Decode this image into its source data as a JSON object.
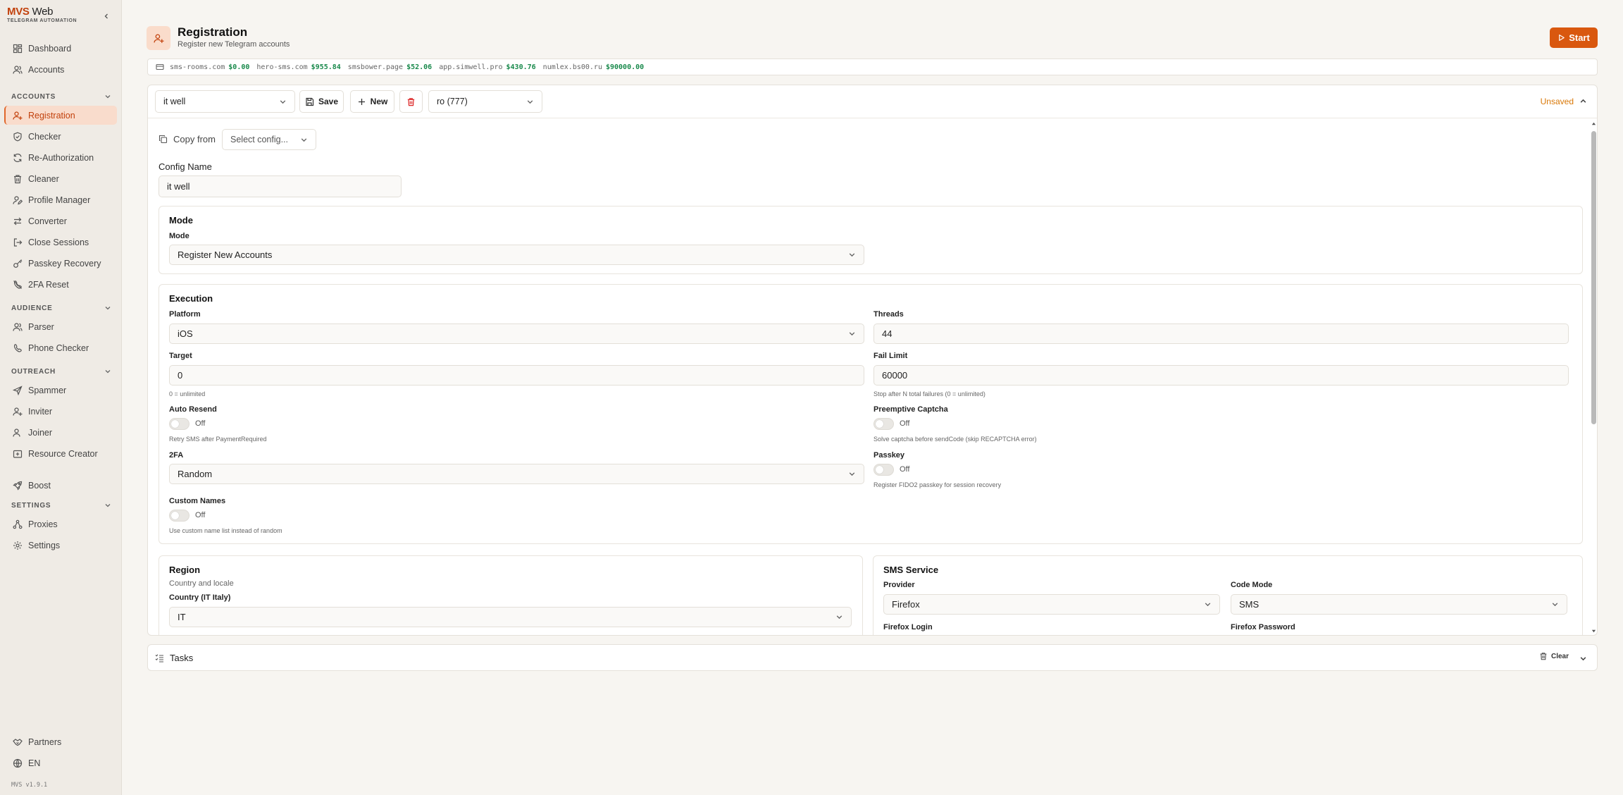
{
  "sidebar": {
    "logo_brand": "MVS",
    "logo_web": "Web",
    "logo_sub": "TELEGRAM AUTOMATION",
    "top_items": [
      {
        "label": "Dashboard",
        "icon": "dashboard-icon"
      },
      {
        "label": "Accounts",
        "icon": "users-icon"
      }
    ],
    "sections": {
      "accounts": {
        "title": "ACCOUNTS",
        "items": [
          {
            "label": "Registration",
            "icon": "user-plus-icon",
            "active": true
          },
          {
            "label": "Checker",
            "icon": "shield-check-icon"
          },
          {
            "label": "Re-Authorization",
            "icon": "refresh-icon"
          },
          {
            "label": "Cleaner",
            "icon": "trash-icon"
          },
          {
            "label": "Profile Manager",
            "icon": "user-edit-icon"
          },
          {
            "label": "Converter",
            "icon": "arrows-swap-icon"
          },
          {
            "label": "Close Sessions",
            "icon": "logout-icon"
          },
          {
            "label": "Passkey Recovery",
            "icon": "key-icon"
          },
          {
            "label": "2FA Reset",
            "icon": "phone-off-icon"
          }
        ]
      },
      "audience": {
        "title": "AUDIENCE",
        "items": [
          {
            "label": "Parser",
            "icon": "users-icon"
          },
          {
            "label": "Phone Checker",
            "icon": "phone-icon"
          }
        ]
      },
      "outreach": {
        "title": "OUTREACH",
        "items": [
          {
            "label": "Spammer",
            "icon": "send-icon"
          },
          {
            "label": "Inviter",
            "icon": "user-plus-icon"
          },
          {
            "label": "Joiner",
            "icon": "user-join-icon"
          },
          {
            "label": "Resource Creator",
            "icon": "folder-plus-icon"
          }
        ]
      },
      "boost": {
        "label": "Boost",
        "icon": "rocket-icon"
      },
      "settings": {
        "title": "SETTINGS",
        "items": [
          {
            "label": "Proxies",
            "icon": "network-icon"
          },
          {
            "label": "Settings",
            "icon": "gear-icon"
          }
        ]
      }
    },
    "bottom_items": [
      {
        "label": "Partners",
        "icon": "handshake-icon"
      },
      {
        "label": "EN",
        "icon": "globe-icon"
      }
    ],
    "version": "MVS v1.9.1"
  },
  "header": {
    "title": "Registration",
    "subtitle": "Register new Telegram accounts",
    "start_label": "Start"
  },
  "balances": [
    {
      "service": "sms-rooms.com",
      "amount": "$0.00"
    },
    {
      "service": "hero-sms.com",
      "amount": "$955.84"
    },
    {
      "service": "smsbower.page",
      "amount": "$52.06"
    },
    {
      "service": "app.simwell.pro",
      "amount": "$430.76"
    },
    {
      "service": "numlex.bs00.ru",
      "amount": "$90000.00"
    }
  ],
  "toolbar": {
    "config_select": "it well",
    "save_label": "Save",
    "new_label": "New",
    "profile_select": "ro (777)",
    "status": "Unsaved"
  },
  "form": {
    "copy_from_label": "Copy from",
    "copy_from_placeholder": "Select config...",
    "config_name_label": "Config Name",
    "config_name_value": "it well",
    "mode_section": {
      "title": "Mode",
      "mode_label": "Mode",
      "mode_value": "Register New Accounts"
    },
    "execution": {
      "title": "Execution",
      "platform_label": "Platform",
      "platform_value": "iOS",
      "threads_label": "Threads",
      "threads_value": "44",
      "target_label": "Target",
      "target_value": "0",
      "target_hint": "0 = unlimited",
      "fail_limit_label": "Fail Limit",
      "fail_limit_value": "60000",
      "fail_limit_hint": "Stop after N total failures (0 = unlimited)",
      "auto_resend_label": "Auto Resend",
      "auto_resend_state": "Off",
      "auto_resend_hint": "Retry SMS after PaymentRequired",
      "preemptive_label": "Preemptive Captcha",
      "preemptive_state": "Off",
      "preemptive_hint": "Solve captcha before sendCode (skip RECAPTCHA error)",
      "twofa_label": "2FA",
      "twofa_value": "Random",
      "passkey_label": "Passkey",
      "passkey_state": "Off",
      "passkey_hint": "Register FIDO2 passkey for session recovery",
      "custom_names_label": "Custom Names",
      "custom_names_state": "Off",
      "custom_names_hint": "Use custom name list instead of random"
    },
    "region": {
      "title": "Region",
      "subtitle": "Country and locale",
      "country_label": "Country (IT Italy)",
      "country_value": "IT"
    },
    "sms_service": {
      "title": "SMS Service",
      "provider_label": "Provider",
      "provider_value": "Firefox",
      "code_mode_label": "Code Mode",
      "code_mode_value": "SMS",
      "login_label": "Firefox Login",
      "password_label": "Firefox Password"
    }
  },
  "tasks": {
    "title": "Tasks",
    "clear_label": "Clear"
  },
  "colors": {
    "accent": "#d9580f",
    "active_bg": "#f9dccc",
    "balance_green": "#1a8a4c",
    "unsaved": "#d97706"
  }
}
